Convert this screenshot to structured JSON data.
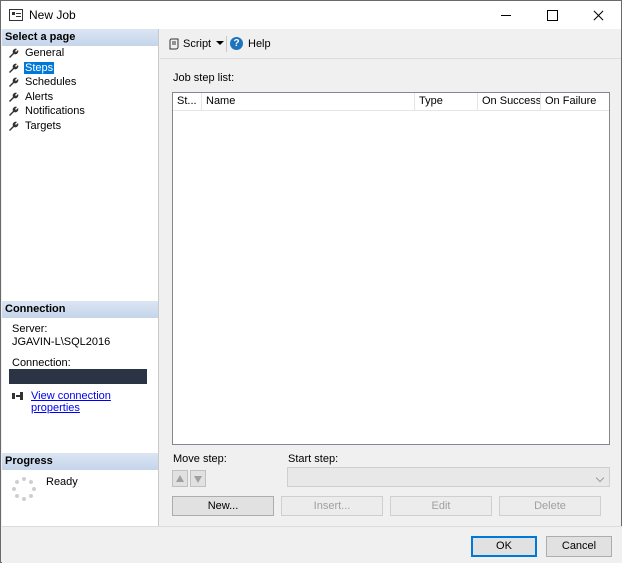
{
  "window": {
    "title": "New Job"
  },
  "left_panel": {
    "select_page_header": "Select a page",
    "pages": [
      {
        "label": "General",
        "selected": false
      },
      {
        "label": "Steps",
        "selected": true
      },
      {
        "label": "Schedules",
        "selected": false
      },
      {
        "label": "Alerts",
        "selected": false
      },
      {
        "label": "Notifications",
        "selected": false
      },
      {
        "label": "Targets",
        "selected": false
      }
    ],
    "connection_header": "Connection",
    "server_label": "Server:",
    "server_value": "JGAVIN-L\\SQL2016",
    "connection_label": "Connection:",
    "view_connection_link": "View connection properties",
    "progress_header": "Progress",
    "progress_status": "Ready"
  },
  "toolbar": {
    "script_label": "Script",
    "help_label": "Help"
  },
  "main": {
    "job_step_list_label": "Job step list:",
    "columns": [
      "St...",
      "Name",
      "Type",
      "On Success",
      "On Failure"
    ],
    "rows": [],
    "move_step_label": "Move step:",
    "start_step_label": "Start step:",
    "start_step_value": "",
    "buttons": {
      "new": "New...",
      "insert": "Insert...",
      "edit": "Edit",
      "delete": "Delete"
    }
  },
  "footer": {
    "ok": "OK",
    "cancel": "Cancel"
  },
  "colors": {
    "selection": "#0078d7",
    "section_header": "#c5d5ea",
    "link": "#0000ee"
  }
}
